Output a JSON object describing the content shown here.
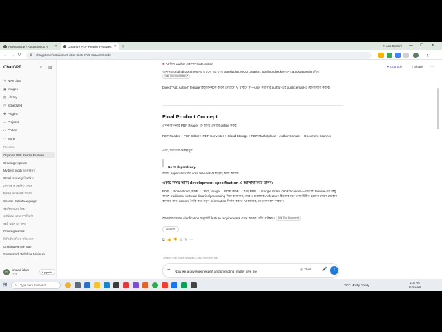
{
  "browser": {
    "tabs": [
      {
        "label": "Agent Mode | Autonomous AI"
      },
      {
        "label": "Organize PDF Reader Features"
      }
    ],
    "new_tab": "+",
    "ask_gemini": "Ask Gemini",
    "url": "chatgpt.com/c/6aac31c0-c34c-83c6-97d5-0a5ae0284cd0"
  },
  "sidebar": {
    "brand": "ChatGPT",
    "nav": [
      {
        "label": "New chat",
        "icon": "pencil-icon"
      },
      {
        "label": "Images",
        "icon": "image-icon"
      },
      {
        "label": "Library",
        "icon": "library-icon"
      },
      {
        "label": "Scheduled",
        "icon": "clock-icon"
      },
      {
        "label": "Plugins",
        "icon": "plugin-icon"
      },
      {
        "label": "Projects",
        "icon": "folder-icon"
      },
      {
        "label": "Codex",
        "icon": "code-icon"
      },
      {
        "label": "More",
        "icon": "dots-icon"
      }
    ],
    "recents_label": "Recents",
    "recents": [
      "Organize PDF Reader Features",
      "Greeting response",
      "My best buddy অভিজ্ঞতা",
      "Gmail recovery বিস্তারিত",
      "ফেসবুক অ্যাকাউন্ট ফেরত",
      "ইমেইল অ্যাকাউন্ট সাহায্য",
      "Choose Output Language",
      "অ্যাকিং ওয়েব লিঙ্ক",
      "ক্যারিয়ার রোডম্যাপ নির্দেশ",
      "আর্ট ড্রয়িং এর জন্য",
      "Greeting Kamrul",
      "ডিজিটাল বিক্রয় পরিকল্পনা",
      "Greeting Kamrul Islam",
      "Shutterstock Withdraw Minimum"
    ],
    "user": {
      "initials": "KI",
      "name": "kmarul islam",
      "plan": "Free",
      "upgrade": "Upgrade"
    }
  },
  "header": {
    "upgrade": "Upgrade",
    "share": "Share"
  },
  "conversation": {
    "line_top": "AI দিয়ে author-এর সাথে interaction",
    "para_doc": "আপনার original document-এ এখনো এর মধ্যে translation, MCQ creation, spelling checker এবং autosuggestion ছিল।",
    "chip_doc": "Talk Tool Document ↗",
    "para_ask": "Direct \"Ask Author\" feature কিছু মানুষকে কারণ সেখানে AI থাকবে না—user সরাসরি author-এর public email-এ যোগাযোগ করবে।",
    "final_title": "Final Product Concept",
    "final_sub": "এখন আপনার PDF Reader কে আমি এভাবে define করব:",
    "concept": "PDF Reader + PDF Editor + PDF Converter + Cloud Storage + PDF Marketplace + Author Contact + Document Scanner",
    "and_note": "এবং, সবচেয়ে গুরুত্বপূর্ণ:",
    "callout": "No AI dependency.",
    "para_core": "অর্থাৎ application-টির core features AI ছাড়াই কাজ করবে।",
    "dev_title": "একটি বিষয় আমি development specification-এ আলাদা করে রাখব:",
    "para_convert": "PDF → PowerPoint, PDF → JPG, Image → PDF, PDF → ZIP, PDF → Google Form, OCR/Scanner—এগুলো feature-এর কিছু অংশে traditional software libraries/processing দিয়ে করা যায়, তবে এগুলোকে AI feature হিসেবে ধরে নেয়া উচিত হবে না যেমন যেকোন কাজের জন্য content তৈরি করে নতুন information নির্মাণ করতে AI লাগবে, সেগুলো বাদ থাকবে।",
    "para_clarify": "আপনার বর্তমান clarification অনুযায়ী feature requirements এখন অনেক বেশি পরিষ্কার।",
    "chip_clarify": "Talk Tool Document",
    "sources": "Sources",
    "actions": [
      "copy-icon",
      "thumbs-up-icon",
      "thumbs-down-icon",
      "share-icon",
      "regenerate-icon",
      "more-icon"
    ]
  },
  "disclaimer": "ChatGPT can make mistakes. Check important info.",
  "composer": {
    "value": "Now ike a developer expert and prompting master give me",
    "think": "Think"
  },
  "taskbar": {
    "search_placeholder": "Type here to search",
    "weather": "28°C  Mostly cloudy",
    "time": "1:04 PM",
    "date": "8/19/2025"
  },
  "colors": {
    "accent": "#1f7bd8",
    "upgrade": "#5b45d6",
    "taskbar": "#e9edf2",
    "tabbar": "#dfe8e0"
  }
}
